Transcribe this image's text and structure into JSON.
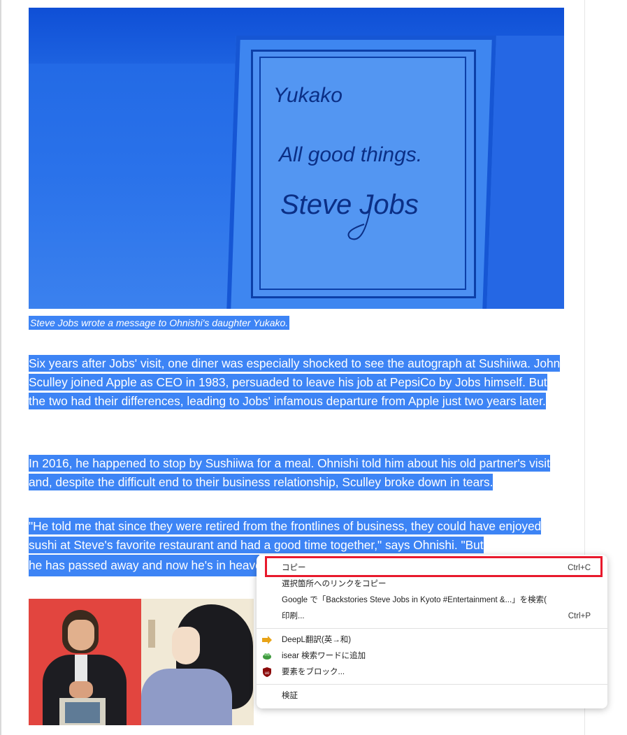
{
  "article": {
    "image_alt": "Framed autograph reading Yukako, All good things, Steve Jobs",
    "signature": {
      "line1": "Yukako",
      "line2": "All good things.",
      "line3": "Steve Jobs"
    },
    "caption": "Steve Jobs wrote a message to Ohnishi's daughter Yukako.",
    "paragraphs": {
      "p1": "Six years after Jobs' visit, one diner was especially shocked to see the autograph at Sushiiwa. John Sculley joined Apple as CEO in 1983, persuaded to leave his job at PepsiCo by Jobs himself. But the two had their differences, leading to Jobs' infamous departure from Apple just two years later.",
      "p2": "In 2016, he happened to stop by Sushiiwa for a meal. Ohnishi told him about his old partner's visit and, despite the difficult end to their business relationship, Sculley broke down in tears.",
      "p3_a": "\"He told me that since they were retired from the frontlines of business, they could have enjoyed sushi at Steve's favorite restaurant and had a good time together,\" says Ohnishi. \"But",
      "p3_b": "he has passed away and now he's in heaven."
    }
  },
  "context_menu": {
    "items": {
      "copy": {
        "label": "コピー",
        "shortcut": "Ctrl+C"
      },
      "copy_link": {
        "label": "選択箇所へのリンクをコピー"
      },
      "google_search": {
        "label": "Google で「Backstories Steve Jobs in Kyoto #Entertainment &...」を検索("
      },
      "print": {
        "label": "印刷...",
        "shortcut": "Ctrl+P"
      },
      "deepl": {
        "label": "DeepL翻訳(英→和)",
        "icon": "deepl-arrow-icon"
      },
      "isear": {
        "label": "isear 検索ワードに追加",
        "icon": "isear-icon"
      },
      "block": {
        "label": "要素をブロック...",
        "icon": "ublock-icon"
      },
      "inspect": {
        "label": "検証"
      }
    },
    "highlight_color": "#e8192c"
  },
  "colors": {
    "selection": "#3d84f5",
    "menu_bg": "#ffffff"
  }
}
